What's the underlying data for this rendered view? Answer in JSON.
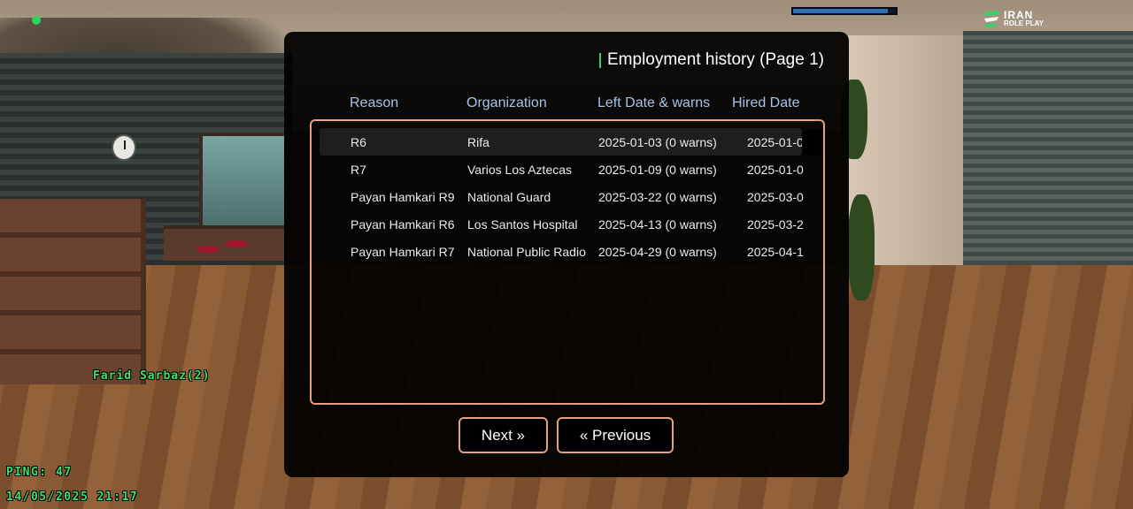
{
  "hud": {
    "brand_line1": "IRAN",
    "brand_line2": "ROLE PLAY",
    "player_name": "Farid Sarbaz(2)",
    "ping": "PING: 47",
    "datetime": "14/05/2025 21:17",
    "status_bar_fraction": 0.92
  },
  "dialog": {
    "title": "Employment history (Page 1)",
    "columns": {
      "reason": "Reason",
      "organization": "Organization",
      "left_date": "Left Date & warns",
      "hired_date": "Hired Date"
    },
    "rows": [
      {
        "reason": "R6",
        "organization": "Rifa",
        "left": "2025-01-03 (0 warns)",
        "hired": "2025-01-0"
      },
      {
        "reason": "R7",
        "organization": "Varios Los Aztecas",
        "left": "2025-01-09 (0 warns)",
        "hired": "2025-01-0"
      },
      {
        "reason": "Payan Hamkari R9",
        "organization": "National Guard",
        "left": "2025-03-22 (0 warns)",
        "hired": "2025-03-0"
      },
      {
        "reason": "Payan Hamkari R6",
        "organization": "Los Santos Hospital",
        "left": "2025-04-13 (0 warns)",
        "hired": "2025-03-2"
      },
      {
        "reason": "Payan Hamkari R7",
        "organization": "National Public Radio",
        "left": "2025-04-29 (0 warns)",
        "hired": "2025-04-1"
      }
    ],
    "selected_row": 0,
    "next_label": "Next »",
    "previous_label": "« Previous"
  },
  "colors": {
    "accent_border": "#e3a27e",
    "header_text": "#a7c3e6",
    "hud_green": "#3be06a",
    "title_accent": "#2fd46a"
  },
  "icons": {
    "brand": "iran-roleplay-logo",
    "radar_dot": "green-dot-icon"
  }
}
